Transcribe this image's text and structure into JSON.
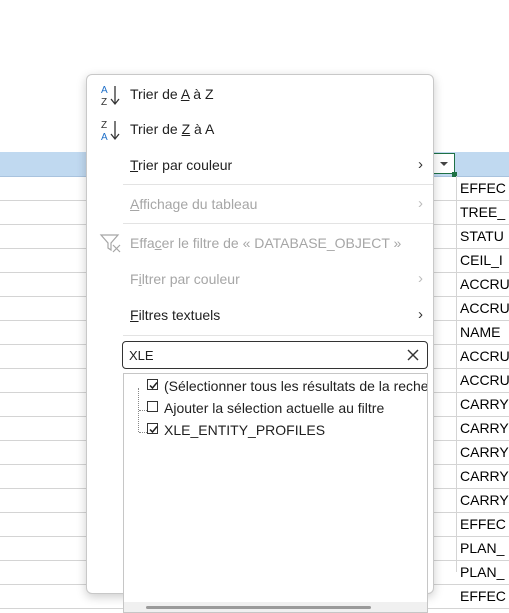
{
  "sheet": {
    "cells": [
      "EFFEC",
      "TREE_",
      "STATU",
      "CEIL_I",
      "ACCRU",
      "ACCRU",
      "NAME",
      "ACCRU",
      "ACCRU",
      "CARRY",
      "CARRY",
      "CARRY",
      "CARRY",
      "CARRY",
      "EFFEC",
      "PLAN_",
      "PLAN_",
      "EFFEC"
    ]
  },
  "menu": {
    "sort_az": {
      "pre": "Trier de ",
      "key": "A",
      "post": " à Z"
    },
    "sort_za": {
      "pre": "Trier de ",
      "key": "Z",
      "post": " à A"
    },
    "sort_color": {
      "key": "T",
      "rest": "rier par couleur"
    },
    "table_view": {
      "key": "A",
      "rest": "ffichage du tableau"
    },
    "clear_filter": {
      "pre": "Effa",
      "key": "c",
      "post": "er le filtre de « DATABASE_OBJECT »"
    },
    "filter_color": {
      "pre": "F",
      "key": "i",
      "post": "ltrer par couleur"
    },
    "text_filters": {
      "key": "F",
      "rest": "iltres textuels"
    },
    "chevron": "›"
  },
  "search": {
    "value": "XLE",
    "placeholder": ""
  },
  "list": {
    "items": [
      {
        "label": "(Sélectionner tous les résultats de la recherche)",
        "checked": true
      },
      {
        "label": "Ajouter la sélection actuelle au filtre",
        "checked": false
      },
      {
        "label": "XLE_ENTITY_PROFILES",
        "checked": true
      }
    ]
  },
  "colors": {
    "accent_green": "#1e7145",
    "header_band": "#c0d9f0",
    "disabled_text": "#a6a6a6"
  }
}
